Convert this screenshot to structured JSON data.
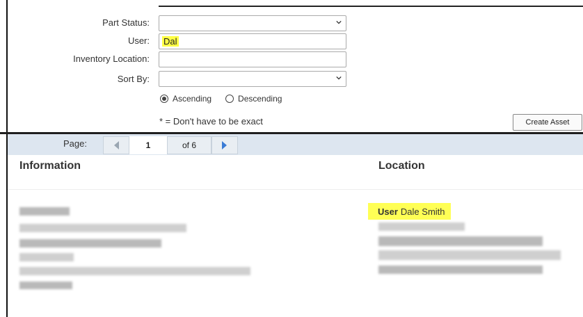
{
  "filters": {
    "part_status_label": "Part Status:",
    "part_status_value": "",
    "user_label": "User:",
    "user_value": "Dal",
    "inventory_location_label": "Inventory Location:",
    "inventory_location_value": "",
    "sort_by_label": "Sort By:",
    "sort_by_value": "",
    "sort_ascending_label": "Ascending",
    "sort_descending_label": "Descending",
    "sort_selected": "Ascending",
    "note": "* = Don't have to be exact"
  },
  "actions": {
    "create_asset_label": "Create Asset"
  },
  "pager": {
    "page_label": "Page:",
    "current_page": "1",
    "of_pages": "of 6"
  },
  "table": {
    "columns": [
      "Information",
      "Location"
    ],
    "rows": [
      {
        "location_user_label": "User",
        "location_user_value": "Dale Smith"
      }
    ]
  },
  "colors": {
    "highlight": "#ffff44",
    "pager_bar": "#dde6f0",
    "pager_arrow": "#3a7bd5"
  },
  "icons": {
    "select_arrow": "chevron-down-icon",
    "prev": "caret-left-icon",
    "next": "caret-right-icon"
  }
}
